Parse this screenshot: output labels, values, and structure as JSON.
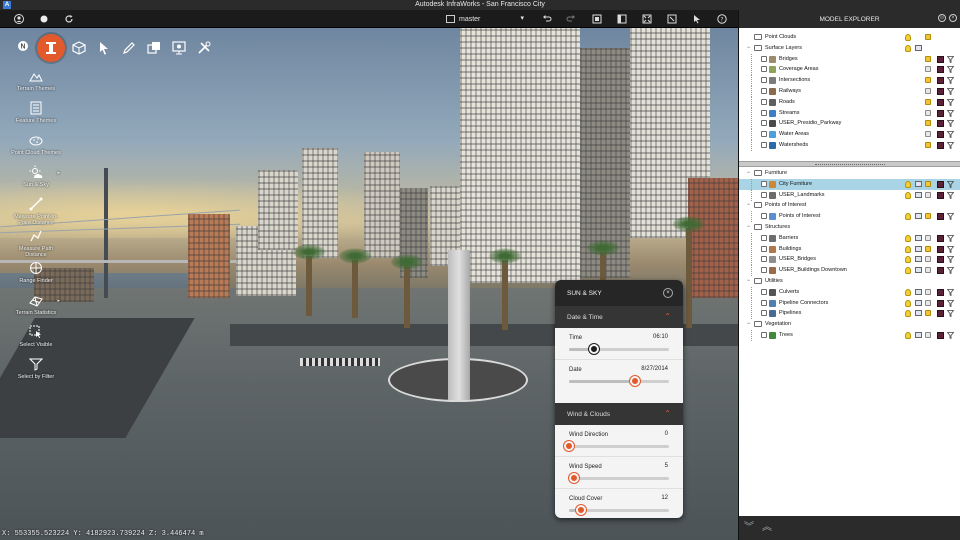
{
  "window": {
    "title": "Autodesk InfraWorks - San Francisco City",
    "app_badge": "A"
  },
  "toolbar": {
    "branch": "master",
    "icons": [
      "user-icon",
      "record-icon",
      "refresh-icon",
      "branch-icon",
      "undo-icon",
      "redo-icon",
      "capture-icon",
      "panel-icon",
      "fullscreen-icon",
      "select-icon",
      "cursor-icon",
      "help-icon"
    ]
  },
  "top_tools": [
    "north-icon",
    "infraworks-logo-icon",
    "cube-icon",
    "select-arrow-icon",
    "sketch-icon",
    "layers-icon",
    "present-icon",
    "tools-icon"
  ],
  "left_tools": [
    {
      "label": "Terrain Themes",
      "icon": "terrain-themes-icon",
      "has_arrow": false
    },
    {
      "label": "Feature Themes",
      "icon": "feature-themes-icon",
      "has_arrow": false
    },
    {
      "label": "Point Cloud Themes",
      "icon": "point-cloud-icon",
      "has_arrow": false
    },
    {
      "label": "Sun & Sky",
      "icon": "sun-sky-icon",
      "has_arrow": true
    },
    {
      "label": "Measure Point-to-Point Distance",
      "icon": "measure-point-icon",
      "has_arrow": false
    },
    {
      "label": "Measure Path Distance",
      "icon": "measure-path-icon",
      "has_arrow": false
    },
    {
      "label": "Range Finder",
      "icon": "range-finder-icon",
      "has_arrow": false
    },
    {
      "label": "Terrain Statistics",
      "icon": "terrain-stats-icon",
      "has_arrow": true
    },
    {
      "label": "Select Visible",
      "icon": "select-visible-icon",
      "has_arrow": false
    },
    {
      "label": "Select by Filter",
      "icon": "select-filter-icon",
      "has_arrow": false
    }
  ],
  "status": {
    "coordinates": "X: 553355.523224 Y: 4182923.739224 Z: 3.446474 m"
  },
  "sun_sky": {
    "title": "SUN & SKY",
    "close": "×",
    "date_time_section": "Date & Time",
    "wind_section": "Wind & Clouds",
    "rows": {
      "time": {
        "label": "Time",
        "value": "06:10",
        "fraction": 0.25
      },
      "date": {
        "label": "Date",
        "value": "8/27/2014",
        "fraction": 0.66
      },
      "wind_direction": {
        "label": "Wind Direction",
        "value": "0",
        "fraction": 0.0
      },
      "wind_speed": {
        "label": "Wind Speed",
        "value": "5",
        "fraction": 0.05
      },
      "cloud_cover": {
        "label": "Cloud Cover",
        "value": "12",
        "fraction": 0.12
      }
    }
  },
  "explorer": {
    "title": "MODEL EXPLORER",
    "top_rows": [
      {
        "name": "Point Clouds",
        "level": 0,
        "kind": "group",
        "expander": ""
      },
      {
        "name": "Surface Layers",
        "level": 0,
        "kind": "group",
        "expander": "−"
      },
      {
        "name": "Bridges",
        "level": 1,
        "kind": "layer",
        "color": "#9c8b6a"
      },
      {
        "name": "Coverage Areas",
        "level": 1,
        "kind": "layer",
        "color": "#8da35a"
      },
      {
        "name": "Intersections",
        "level": 1,
        "kind": "layer",
        "color": "#7b7b7b"
      },
      {
        "name": "Railways",
        "level": 1,
        "kind": "layer",
        "color": "#8b6a4a"
      },
      {
        "name": "Roads",
        "level": 1,
        "kind": "layer",
        "color": "#5e5e5e"
      },
      {
        "name": "Streams",
        "level": 1,
        "kind": "layer",
        "color": "#3b7fc4"
      },
      {
        "name": "USER_Presidio_Parkway",
        "level": 1,
        "kind": "layer",
        "color": "#4a4a4a"
      },
      {
        "name": "Water Areas",
        "level": 1,
        "kind": "layer",
        "color": "#4d9fd9"
      },
      {
        "name": "Watersheds",
        "level": 1,
        "kind": "layer",
        "color": "#2a6aa8"
      }
    ],
    "bottom_rows": [
      {
        "name": "Furniture",
        "level": 0,
        "kind": "group",
        "expander": "−"
      },
      {
        "name": "City Furniture",
        "level": 1,
        "kind": "layer",
        "color": "#c9883a",
        "selected": true
      },
      {
        "name": "USER_Landmarks",
        "level": 1,
        "kind": "layer",
        "color": "#6b6b6b"
      },
      {
        "name": "Points of Interest",
        "level": 0,
        "kind": "group",
        "expander": "−"
      },
      {
        "name": "Points of Interest",
        "level": 1,
        "kind": "layer",
        "color": "#5a8fd0"
      },
      {
        "name": "Structures",
        "level": 0,
        "kind": "group",
        "expander": "−"
      },
      {
        "name": "Barriers",
        "level": 1,
        "kind": "layer",
        "color": "#6d6d6d"
      },
      {
        "name": "Buildings",
        "level": 1,
        "kind": "layer",
        "color": "#b0784a"
      },
      {
        "name": "USER_Bridges",
        "level": 1,
        "kind": "layer",
        "color": "#8e8e8e"
      },
      {
        "name": "USER_Buildings Downtown",
        "level": 1,
        "kind": "layer",
        "color": "#9a6a4a"
      },
      {
        "name": "Utilities",
        "level": 0,
        "kind": "group",
        "expander": "−"
      },
      {
        "name": "Culverts",
        "level": 1,
        "kind": "layer",
        "color": "#555555"
      },
      {
        "name": "Pipeline Connectors",
        "level": 1,
        "kind": "layer",
        "color": "#4f7fb3"
      },
      {
        "name": "Pipelines",
        "level": 1,
        "kind": "layer",
        "color": "#4a6a96"
      },
      {
        "name": "Vegetation",
        "level": 0,
        "kind": "group",
        "expander": "−"
      },
      {
        "name": "Trees",
        "level": 1,
        "kind": "layer",
        "color": "#3f8a3a"
      }
    ]
  },
  "colors": {
    "accent": "#e2592b",
    "swatch": "#5a2138",
    "selected_row": "#a9d4e6"
  }
}
